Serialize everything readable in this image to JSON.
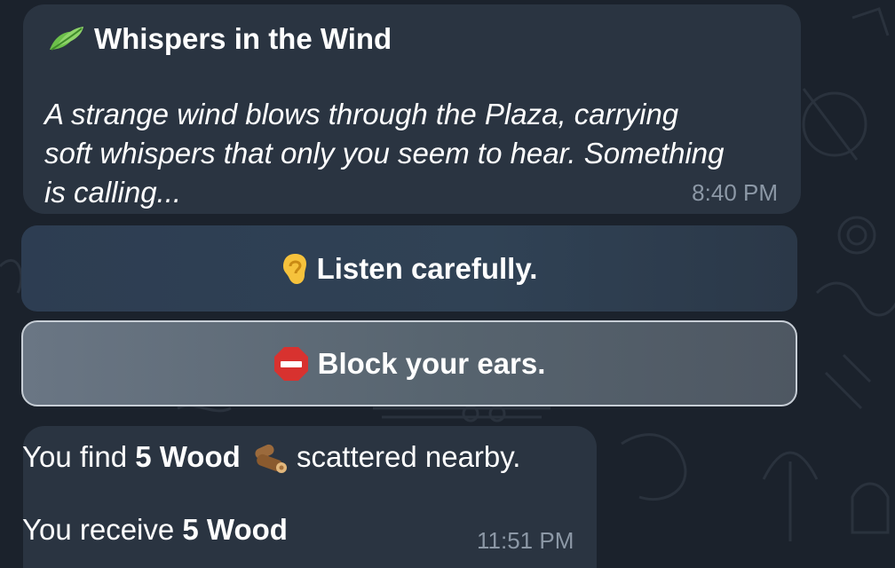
{
  "message1": {
    "title_icon": "leaf-icon",
    "title": "Whispers in the Wind",
    "body_line1": "A strange wind blows through the Plaza, carrying",
    "body_line2": "soft whispers that only you seem to hear. Something",
    "body_line3": "is calling...",
    "time": "8:40 PM"
  },
  "buttons": [
    {
      "icon": "ear-icon",
      "label": "Listen carefully."
    },
    {
      "icon": "stop-sign-icon",
      "label": "Block your ears."
    }
  ],
  "message2": {
    "line1_prefix": "You find ",
    "line1_bold": "5 Wood",
    "line1_icon": "wood-log-icon",
    "line1_suffix": " scattered nearby.",
    "line2_prefix": "You receive ",
    "line2_bold": "5 Wood",
    "time": "11:51 PM"
  },
  "colors": {
    "background": "#1b222c",
    "bubble": "#2a3441",
    "timestamp": "#8c98a6",
    "selected_button_border": "#c7ced6"
  }
}
